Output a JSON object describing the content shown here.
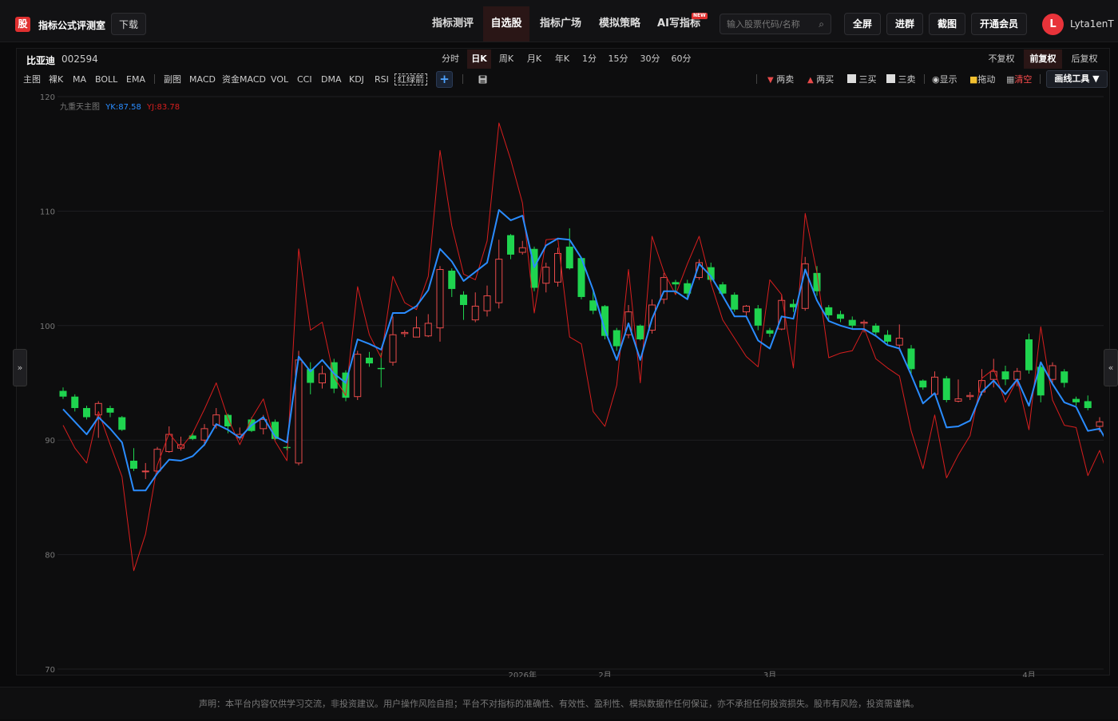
{
  "header": {
    "logo_char": "股",
    "app_title": "指标公式评测室",
    "download_label": "下载",
    "nav": [
      {
        "label": "指标测评",
        "active": false
      },
      {
        "label": "自选股",
        "active": true
      },
      {
        "label": "指标广场",
        "active": false
      },
      {
        "label": "模拟策略",
        "active": false
      },
      {
        "label": "AI写指标",
        "active": false
      }
    ],
    "new_badge": "NEW",
    "search_placeholder": "输入股票代码/名称",
    "buttons": [
      "全屏",
      "进群",
      "截图",
      "开通会员"
    ],
    "user_initial": "L",
    "username": "Lyta1enT"
  },
  "stock": {
    "name": "比亚迪",
    "code": "002594"
  },
  "periods": [
    "分时",
    "日K",
    "周K",
    "月K",
    "年K",
    "1分",
    "15分",
    "30分",
    "60分"
  ],
  "active_period": "日K",
  "fuquan": [
    "不复权",
    "前复权",
    "后复权"
  ],
  "active_fuquan": "前复权",
  "indicators_main": [
    "主图",
    "裸K",
    "MA",
    "BOLL",
    "EMA"
  ],
  "indicators_sub": [
    "副图",
    "MACD",
    "资金MACD",
    "VOL",
    "CCI",
    "DMA",
    "KDJ",
    "RSI"
  ],
  "indicator_boxed": "红绿箭",
  "tools": {
    "sell2": "两卖",
    "buy2": "两买",
    "buy3": "三买",
    "sell3": "三卖",
    "show": "显示",
    "drag": "拖动",
    "clear": "清空",
    "draw_tools": "画线工具 ▼"
  },
  "side_left": "»",
  "side_right": "«",
  "disclaimer": "声明：本平台内容仅供学习交流，非投资建议。用户操作风险自担；平台不对指标的准确性、有效性、盈利性、模拟数据作任何保证，亦不承担任何投资损失。股市有风险，投资需谨慎。",
  "colors": {
    "up": "#e84a4a",
    "down": "#1fd44f",
    "yk": "#2a8cff",
    "yj": "#d81e1e",
    "accent_red": "#e03030"
  },
  "chart_data": {
    "type": "candlestick",
    "title": "",
    "legend": [
      {
        "label": "九重天主图",
        "color": "#777777"
      },
      {
        "label": "YK:87.58",
        "color": "#2a8cff"
      },
      {
        "label": "YJ:83.78",
        "color": "#d81e1e"
      }
    ],
    "ylim": [
      70,
      120
    ],
    "yticks": [
      70,
      80,
      90,
      100,
      110,
      120
    ],
    "xticks": [
      {
        "label": "2026年",
        "index": 39
      },
      {
        "label": "2月",
        "index": 46
      },
      {
        "label": "3月",
        "index": 60
      },
      {
        "label": "4月",
        "index": 82
      }
    ],
    "candles": [
      [
        94.3,
        93.8,
        94.6,
        93.6
      ],
      [
        93.8,
        92.8,
        94.0,
        92.5
      ],
      [
        92.8,
        92.0,
        93.0,
        91.8
      ],
      [
        92.2,
        93.2,
        93.4,
        90.2
      ],
      [
        92.8,
        92.4,
        93.0,
        92.0
      ],
      [
        92.0,
        90.9,
        92.1,
        90.8
      ],
      [
        88.2,
        87.5,
        89.3,
        87.3
      ],
      [
        87.3,
        87.3,
        88.0,
        86.6
      ],
      [
        87.3,
        89.2,
        89.4,
        87.0
      ],
      [
        89.0,
        90.5,
        91.2,
        88.9
      ],
      [
        89.3,
        89.6,
        90.3,
        89.1
      ],
      [
        90.4,
        90.1,
        90.6,
        90.0
      ],
      [
        90.0,
        91.0,
        91.4,
        89.5
      ],
      [
        91.3,
        92.2,
        92.8,
        91.0
      ],
      [
        92.2,
        91.2,
        92.3,
        90.6
      ],
      [
        90.2,
        90.5,
        91.1,
        90.0
      ],
      [
        91.8,
        90.8,
        92.0,
        90.7
      ],
      [
        91.0,
        91.8,
        92.2,
        90.5
      ],
      [
        91.6,
        90.1,
        91.8,
        90.0
      ],
      [
        89.4,
        89.3,
        89.5,
        89.1
      ],
      [
        88.0,
        97.0,
        97.8,
        87.8
      ],
      [
        96.2,
        95.0,
        96.8,
        94.0
      ],
      [
        95.0,
        95.8,
        96.5,
        94.5
      ],
      [
        96.8,
        94.5,
        97.1,
        94.1
      ],
      [
        95.9,
        93.7,
        96.1,
        93.4
      ],
      [
        93.8,
        97.5,
        97.8,
        93.5
      ],
      [
        97.2,
        96.7,
        97.7,
        96.4
      ],
      [
        96.3,
        96.2,
        97.6,
        94.6
      ],
      [
        96.8,
        99.2,
        100.8,
        96.5
      ],
      [
        99.3,
        99.4,
        99.6,
        99.0
      ],
      [
        99.0,
        99.8,
        100.8,
        99.0
      ],
      [
        99.1,
        100.2,
        101.0,
        99.0
      ],
      [
        99.8,
        104.9,
        105.2,
        98.6
      ],
      [
        104.8,
        103.2,
        105.0,
        102.5
      ],
      [
        102.7,
        101.8,
        103.0,
        100.5
      ],
      [
        100.5,
        101.7,
        102.9,
        100.3
      ],
      [
        101.3,
        102.6,
        103.5,
        100.8
      ],
      [
        102.0,
        105.8,
        107.5,
        101.5
      ],
      [
        107.9,
        106.2,
        108.0,
        105.8
      ],
      [
        106.4,
        106.8,
        107.4,
        106.2
      ],
      [
        106.7,
        103.3,
        106.9,
        103.0
      ],
      [
        103.7,
        105.1,
        105.5,
        102.9
      ],
      [
        103.8,
        106.3,
        106.8,
        103.4
      ],
      [
        106.9,
        105.0,
        108.5,
        104.9
      ],
      [
        105.9,
        102.5,
        106.0,
        102.3
      ],
      [
        102.2,
        101.3,
        103.1,
        101.0
      ],
      [
        101.7,
        99.1,
        101.8,
        98.8
      ],
      [
        99.6,
        98.2,
        99.8,
        97.8
      ],
      [
        99.2,
        101.2,
        101.8,
        98.9
      ],
      [
        100.0,
        98.8,
        100.1,
        98.7
      ],
      [
        99.6,
        101.8,
        102.3,
        99.3
      ],
      [
        102.3,
        104.2,
        104.6,
        101.9
      ],
      [
        103.8,
        103.6,
        104.0,
        102.8
      ],
      [
        103.7,
        102.8,
        104.0,
        102.4
      ],
      [
        104.2,
        105.5,
        105.8,
        104.0
      ],
      [
        105.1,
        104.0,
        105.5,
        103.8
      ],
      [
        103.6,
        102.8,
        103.8,
        102.6
      ],
      [
        102.7,
        101.4,
        102.9,
        101.2
      ],
      [
        101.2,
        101.7,
        101.8,
        100.8
      ],
      [
        101.5,
        100.0,
        101.8,
        99.6
      ],
      [
        99.6,
        99.3,
        99.8,
        99.0
      ],
      [
        99.7,
        102.2,
        102.7,
        99.6
      ],
      [
        101.9,
        101.6,
        102.3,
        101.2
      ],
      [
        101.5,
        105.4,
        106.0,
        101.3
      ],
      [
        104.6,
        103.0,
        105.2,
        102.6
      ],
      [
        101.6,
        100.9,
        101.8,
        100.5
      ],
      [
        101.0,
        100.6,
        101.3,
        100.3
      ],
      [
        100.5,
        100.0,
        100.8,
        99.7
      ],
      [
        100.2,
        100.3,
        100.5,
        99.4
      ],
      [
        100.0,
        99.4,
        100.2,
        99.1
      ],
      [
        99.2,
        98.6,
        99.6,
        98.4
      ],
      [
        98.3,
        98.9,
        100.1,
        97.8
      ],
      [
        98.0,
        96.2,
        98.3,
        95.8
      ],
      [
        95.2,
        94.6,
        95.3,
        94.4
      ],
      [
        94.0,
        95.5,
        96.0,
        94.0
      ],
      [
        95.4,
        93.5,
        95.6,
        93.3
      ],
      [
        93.4,
        93.6,
        95.3,
        93.3
      ],
      [
        93.8,
        93.9,
        94.2,
        93.5
      ],
      [
        94.2,
        95.2,
        96.2,
        93.9
      ],
      [
        95.3,
        96.0,
        97.1,
        94.6
      ],
      [
        96.0,
        95.3,
        96.5,
        94.8
      ],
      [
        95.3,
        96.0,
        96.3,
        94.7
      ],
      [
        98.8,
        96.1,
        99.3,
        95.8
      ],
      [
        96.4,
        93.9,
        96.8,
        93.3
      ],
      [
        95.3,
        96.5,
        96.8,
        95.0
      ],
      [
        96.0,
        95.0,
        96.2,
        94.6
      ],
      [
        93.6,
        93.3,
        93.8,
        93.0
      ],
      [
        93.4,
        92.8,
        93.9,
        92.6
      ],
      [
        91.2,
        91.6,
        92.0,
        90.7
      ],
      [
        91.4,
        91.9,
        92.2,
        90.3
      ],
      [
        91.2,
        90.6,
        91.3,
        90.2
      ],
      [
        90.2,
        89.2,
        90.9,
        88.9
      ]
    ],
    "series": [
      {
        "name": "YK",
        "values": [
          92.7,
          91.6,
          90.5,
          92.0,
          91.0,
          89.8,
          85.6,
          85.6,
          87.1,
          88.3,
          88.2,
          88.6,
          89.6,
          91.4,
          90.9,
          90.2,
          91.3,
          92.0,
          90.3,
          89.8,
          97.3,
          96.0,
          97.0,
          95.8,
          95.0,
          98.8,
          98.4,
          97.9,
          101.1,
          101.1,
          101.7,
          103.1,
          106.7,
          105.6,
          103.9,
          104.7,
          105.5,
          110.1,
          109.2,
          109.6,
          105.1,
          107.0,
          107.6,
          107.5,
          105.9,
          103.1,
          99.6,
          97.0,
          100.2,
          97.0,
          100.6,
          103.0,
          103.0,
          102.3,
          105.4,
          104.3,
          102.6,
          100.8,
          100.8,
          98.7,
          98.0,
          100.8,
          100.6,
          104.9,
          102.2,
          100.4,
          100.0,
          99.7,
          99.7,
          99.1,
          98.3,
          98.0,
          95.7,
          93.2,
          94.1,
          91.1,
          91.2,
          91.7,
          94.2,
          95.2,
          94.0,
          95.3,
          93.0,
          96.8,
          94.9,
          93.3,
          92.9,
          90.8,
          91.0,
          89.2,
          87.6
        ]
      },
      {
        "name": "YJ",
        "values": [
          91.3,
          89.3,
          88.0,
          92.5,
          89.6,
          86.8,
          78.6,
          81.8,
          87.8,
          90.6,
          89.3,
          90.6,
          92.7,
          95.0,
          91.9,
          89.6,
          91.9,
          93.6,
          89.9,
          88.2,
          106.7,
          99.6,
          100.3,
          95.5,
          93.9,
          103.4,
          99.2,
          97.2,
          104.3,
          102.0,
          101.4,
          104.3,
          115.3,
          108.7,
          104.5,
          104.0,
          107.4,
          117.7,
          114.5,
          110.7,
          101.1,
          107.5,
          107.6,
          99.0,
          98.4,
          92.5,
          91.2,
          94.8,
          104.9,
          95.0,
          107.8,
          104.7,
          102.7,
          105.4,
          107.8,
          103.7,
          100.5,
          98.9,
          97.3,
          96.4,
          104.0,
          102.7,
          96.3,
          109.8,
          104.6,
          97.2,
          97.6,
          97.8,
          99.8,
          97.1,
          96.3,
          95.6,
          90.8,
          87.5,
          92.2,
          86.7,
          88.7,
          90.4,
          95.4,
          96.2,
          93.3,
          95.3,
          90.9,
          99.9,
          93.5,
          91.3,
          91.1,
          86.9,
          89.1,
          85.9,
          83.8
        ]
      }
    ]
  }
}
